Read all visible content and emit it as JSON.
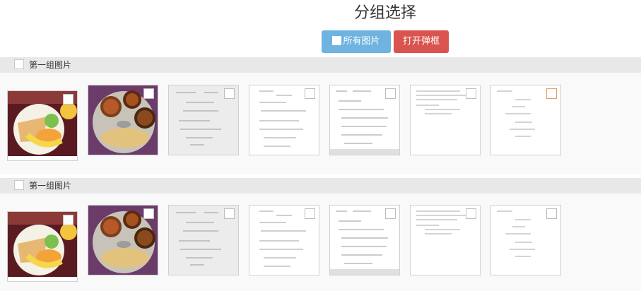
{
  "page": {
    "title": "分组选择"
  },
  "toolbar": {
    "all_images_label": "所有图片",
    "open_dialog_label": "打开弹框",
    "colors": {
      "all_images_bg": "#6fb3e0",
      "open_dialog_bg": "#d9534f"
    }
  },
  "groups": [
    {
      "label": "第一组图片",
      "thumbnails": [
        {
          "icon": "food-photo-breakfast",
          "selected": false
        },
        {
          "icon": "food-photo-curry",
          "selected": false
        },
        {
          "icon": "handwritten-notes",
          "selected": false
        },
        {
          "icon": "handwritten-notes",
          "selected": false
        },
        {
          "icon": "handwritten-notes",
          "selected": false
        },
        {
          "icon": "handwritten-notes",
          "selected": false
        },
        {
          "icon": "handwritten-notes",
          "selected": false,
          "highlight": true
        }
      ]
    },
    {
      "label": "第一组图片",
      "thumbnails": [
        {
          "icon": "food-photo-breakfast",
          "selected": false
        },
        {
          "icon": "food-photo-curry",
          "selected": false
        },
        {
          "icon": "handwritten-notes",
          "selected": false
        },
        {
          "icon": "handwritten-notes",
          "selected": false
        },
        {
          "icon": "handwritten-notes",
          "selected": false
        },
        {
          "icon": "handwritten-notes",
          "selected": false
        },
        {
          "icon": "handwritten-notes",
          "selected": false
        }
      ]
    }
  ]
}
